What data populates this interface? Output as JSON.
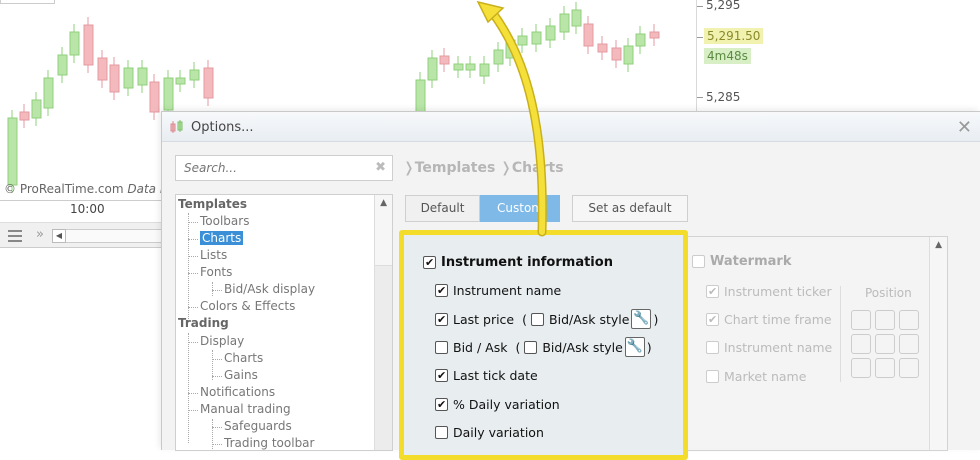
{
  "chart": {
    "price_labels": [
      "5,295",
      "5,291.50",
      "5,285"
    ],
    "timer": "4m48s",
    "copyright": "© ProRealTime.com",
    "data_text": "Data r",
    "time_label": "10:00"
  },
  "options": {
    "title": "Options...",
    "search_placeholder": "Search...",
    "breadcrumb": [
      "Templates",
      "Charts"
    ],
    "tabs": {
      "default": "Default",
      "custom": "Custom"
    },
    "set_default": "Set as default",
    "tree": {
      "templates": "Templates",
      "toolbars": "Toolbars",
      "charts": "Charts",
      "lists": "Lists",
      "fonts": "Fonts",
      "bidask_display": "Bid/Ask display",
      "colors_effects": "Colors & Effects",
      "trading": "Trading",
      "display": "Display",
      "display_charts": "Charts",
      "gains": "Gains",
      "notifications": "Notifications",
      "manual_trading": "Manual trading",
      "safeguards": "Safeguards",
      "trading_toolbar": "Trading toolbar"
    },
    "instrument": {
      "title": "Instrument information",
      "name": "Instrument name",
      "last_price": "Last price",
      "bidask_style": "Bid/Ask style",
      "bid_ask": "Bid / Ask",
      "last_tick_date": "Last tick date",
      "pct_daily_variation": "% Daily variation",
      "daily_variation": "Daily variation",
      "open_paren": "(",
      "close_paren": ")"
    },
    "watermark": {
      "title": "Watermark",
      "ticker": "Instrument ticker",
      "time_frame": "Chart time frame",
      "name": "Instrument name",
      "market": "Market name",
      "position": "Position"
    }
  },
  "colors": {
    "highlight": "#f3dd2a",
    "selected": "#3b8fd6",
    "tab_active": "#7fb9e8",
    "candle_up": "#b9e6a8",
    "candle_down": "#f4b9bd"
  }
}
